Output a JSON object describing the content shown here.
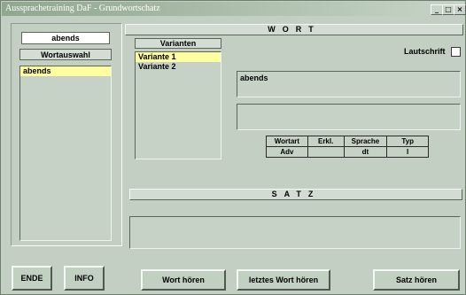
{
  "window": {
    "title": "Aussprachetraining DaF - Grundwortschatz",
    "controls": [
      "_",
      "□",
      "×"
    ]
  },
  "left": {
    "current_word": "abends",
    "word_select_label": "Wortauswahl",
    "word_list": [
      {
        "label": "abends",
        "selected": true
      }
    ]
  },
  "wort": {
    "header": "WORT",
    "variants_header": "Varianten",
    "variants": [
      {
        "label": "Variante 1",
        "selected": true
      },
      {
        "label": "Variante 2",
        "selected": false
      }
    ],
    "lautschrift_label": "Lautschrift",
    "lautschrift_checked": false,
    "word_display": "abends",
    "second_display": "",
    "grammar": {
      "headers": [
        "Wortart",
        "Erkl.",
        "Sprache",
        "Typ"
      ],
      "values": [
        "Adv",
        "",
        "dt",
        "I"
      ]
    }
  },
  "satz": {
    "header": "SATZ",
    "sentence": ""
  },
  "buttons": {
    "ende": "ENDE",
    "info": "INFO",
    "wort_hoeren": "Wort hören",
    "letztes_wort_hoeren": "letztes Wort hören",
    "satz_hoeren": "Satz hören"
  },
  "colors": {
    "window_bg": "#c2cfc2",
    "selection": "#ffffa0",
    "titlebar": "#8fa78f"
  }
}
